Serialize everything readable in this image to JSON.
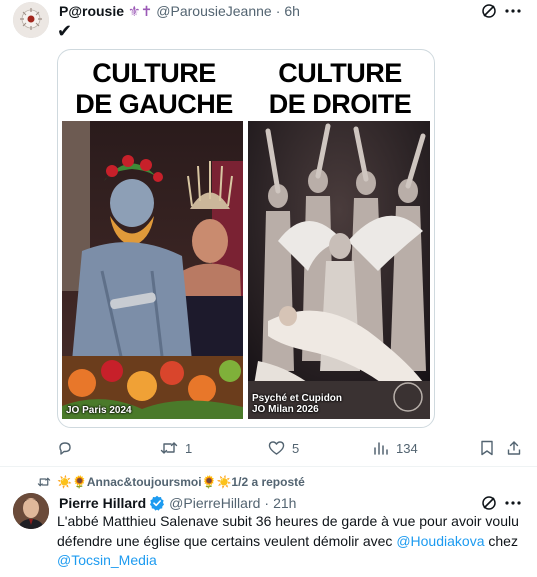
{
  "tweet1": {
    "display_name": "P@rousie",
    "name_emojis": "⚜✝",
    "handle": "@ParousieJeanne",
    "separator": "·",
    "time": "6h",
    "body": "✔",
    "meme": {
      "left_title_line1": "CULTURE",
      "left_title_line2": "DE GAUCHE",
      "right_title_line1": "CULTURE",
      "right_title_line2": "DE DROITE",
      "left_caption": "JO Paris 2024",
      "right_caption_line1": "Psyché et Cupidon",
      "right_caption_line2": "JO Milan 2026"
    },
    "actions": {
      "retweets": "1",
      "likes": "5",
      "views": "134"
    }
  },
  "repost_bar": {
    "text": "☀️🌻Annac&toujoursmoi🌻☀️1/2 a reposté"
  },
  "tweet2": {
    "display_name": "Pierre Hillard",
    "handle": "@PierreHillard",
    "separator": "·",
    "time": "21h",
    "body_part1": "L'abbé Matthieu Salenave subit 36 heures de garde à vue pour avoir voulu défendre une église que certains veulent démolir avec ",
    "mention1": "@Houdiakova",
    "body_part2": " chez ",
    "mention2": "@Tocsin_Media"
  },
  "colors": {
    "text": "#0f1419",
    "muted": "#536471",
    "link": "#1d9bf0",
    "verified": "#1d9bf0",
    "divider": "#eff3f4"
  }
}
